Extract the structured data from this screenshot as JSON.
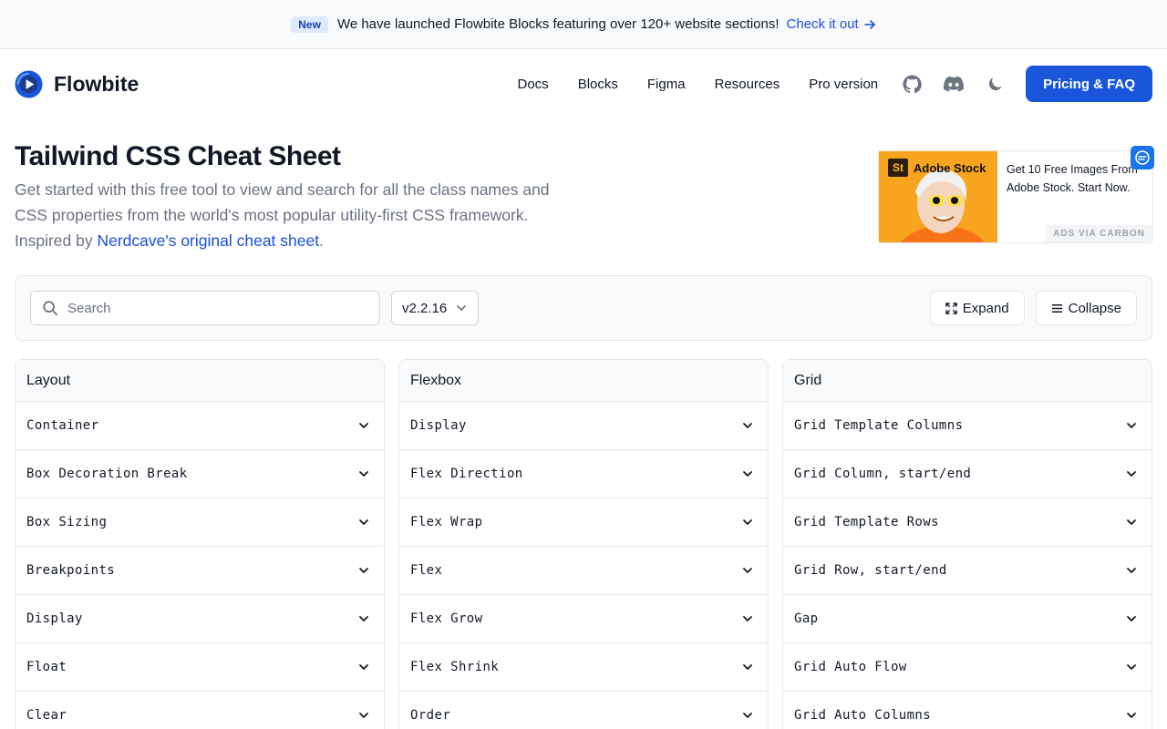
{
  "banner": {
    "badge": "New",
    "text": "We have launched Flowbite Blocks featuring over 120+ website sections!",
    "link": "Check it out"
  },
  "nav": {
    "brand": "Flowbite",
    "links": [
      "Docs",
      "Blocks",
      "Figma",
      "Resources",
      "Pro version"
    ],
    "icons": [
      "github-icon",
      "discord-icon",
      "moon-icon"
    ],
    "cta": "Pricing & FAQ"
  },
  "hero": {
    "title": "Tailwind CSS Cheat Sheet",
    "desc": "Get started with this free tool to view and search for all the class names and CSS properties from the world's most popular utility-first CSS framework. Inspired by ",
    "link": "Nerdcave's original cheat sheet",
    "suffix": "."
  },
  "ad": {
    "brand": "Adobe Stock",
    "brand_mark": "St",
    "text": "Get 10 Free Images From Adobe Stock. Start Now.",
    "via": "ADS VIA CARBON"
  },
  "toolbar": {
    "search_placeholder": "Search",
    "version": "v2.2.16",
    "expand": "Expand",
    "collapse": "Collapse"
  },
  "columns": [
    {
      "title": "Layout",
      "items": [
        "Container",
        "Box Decoration Break",
        "Box Sizing",
        "Breakpoints",
        "Display",
        "Float",
        "Clear"
      ]
    },
    {
      "title": "Flexbox",
      "items": [
        "Display",
        "Flex Direction",
        "Flex Wrap",
        "Flex",
        "Flex Grow",
        "Flex Shrink",
        "Order"
      ]
    },
    {
      "title": "Grid",
      "items": [
        "Grid Template Columns",
        "Grid Column, start/end",
        "Grid Template Rows",
        "Grid Row, start/end",
        "Gap",
        "Grid Auto Flow",
        "Grid Auto Columns"
      ]
    }
  ],
  "colors": {
    "accent": "#1a56db",
    "link": "#1d4ed8",
    "badge_bg": "#dbeafe"
  }
}
